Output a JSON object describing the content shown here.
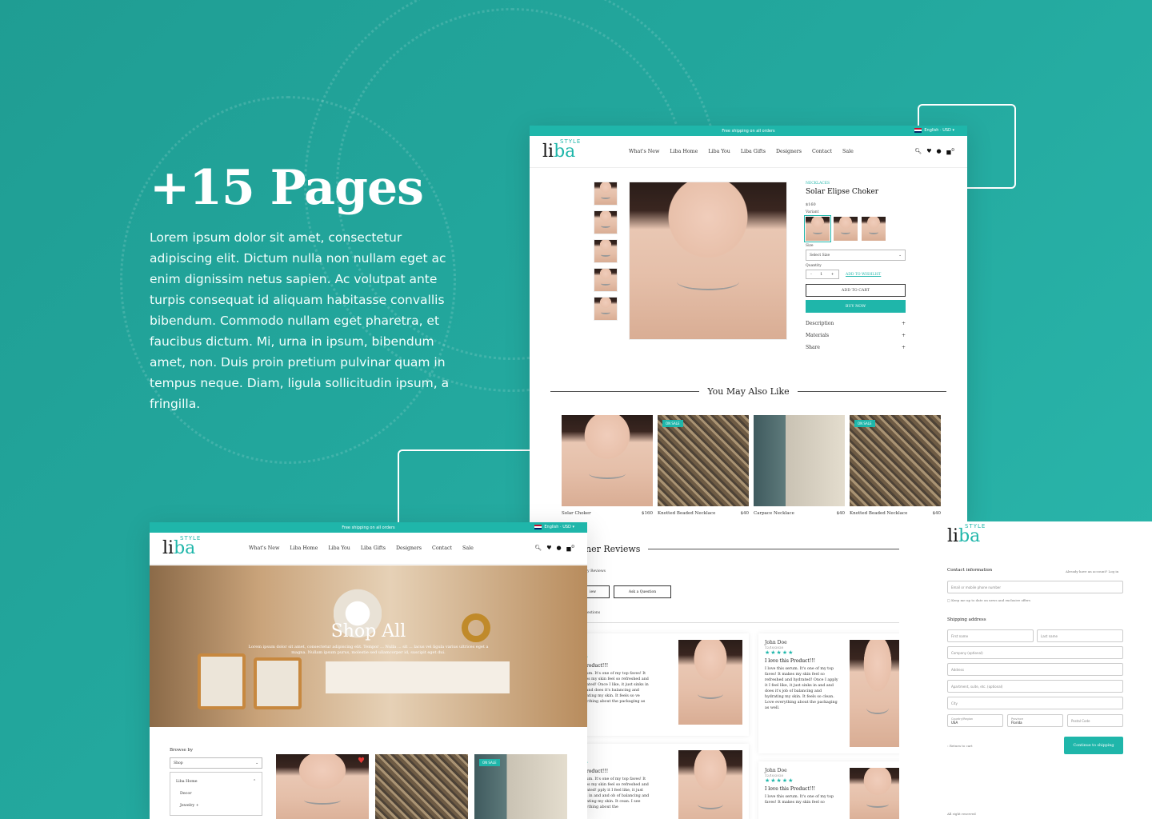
{
  "hero": {
    "title": "+15 Pages",
    "text": "Lorem ipsum dolor sit amet, consectetur adipiscing elit. Dictum nulla non nullam eget ac enim dignissim netus sapien. Ac volutpat ante turpis consequat id aliquam habitasse convallis bibendum. Commodo nullam eget pharetra, et faucibus dictum. Mi, urna in ipsum, bibendum amet, non. Duis proin pretium pulvinar quam in tempus neque. Diam, ligula sollicitudin ipsum, a fringilla."
  },
  "site": {
    "promo": "Free shipping on all orders",
    "lang": "English · USD ▾",
    "logo_main": "li",
    "logo_accent": "ba",
    "logo_sup": "STYLE",
    "nav": [
      "What's New",
      "Liba Home",
      "Liba You",
      "Liba Gifts",
      "Designers",
      "Contact",
      "Sale"
    ],
    "icons": [
      "search-icon",
      "heart-icon",
      "user-icon",
      "bag-icon"
    ],
    "cart_count": "0"
  },
  "product": {
    "category": "NECKLACES",
    "name": "Solar Elipse Choker",
    "price": "$160",
    "variant_label": "Variant",
    "size_label": "Size",
    "size_placeholder": "Select Size",
    "quantity_label": "Quantity",
    "quantity": "1",
    "wishlist": "ADD TO WISHLIST",
    "add_to_cart": "ADD TO CART",
    "buy_now": "BUY NOW",
    "accordion": [
      "Description",
      "Materials",
      "Share"
    ],
    "section_title": "You May Also Like",
    "recommend": [
      {
        "name": "Solar Choker",
        "price": "$160",
        "sale": ""
      },
      {
        "name": "Knotted Beaded Necklace",
        "price": "$40",
        "sale": "ON SALE"
      },
      {
        "name": "Carpace Necklace",
        "price": "$40",
        "sale": ""
      },
      {
        "name": "Knotted Beaded Necklace",
        "price": "$40",
        "sale": "ON SALE"
      }
    ]
  },
  "reviews": {
    "title_visible": "ner Reviews",
    "subtitle": "ry Reviews",
    "write_btn": "iew",
    "ask_btn": "Ask a Question",
    "tab": "estions",
    "cards": [
      {
        "name": "",
        "date": "",
        "stars": "★★",
        "title": "is Product!!!",
        "body": "l serum. It's one of my top faves! It makes my skin feel so refreshed and hydrated! Once I like, it just sinks in and and does it's balancing and hydrating my skin. It feels so ve everything about the packaging as well."
      },
      {
        "name": "John Doe",
        "date": "12/10/2020",
        "stars": "★★★★★",
        "title": "I love this Product!!!",
        "body": "I love this serum. It's one of my top faves! It makes my skin feel so refreshed and hydrated! Once I apply it I feel like, it just sinks in and and does it's job of balancing and hydrating my skin. It feels so clean. Love everything about the packaging as well."
      },
      {
        "name": "e",
        "date": "0",
        "stars": "★★",
        "title": "is Product!!!",
        "body": "l serum. It's one of my top faves! It makes my skin feel so refreshed and hydrated! pply it I feel like, it just sinks in and and ob of balancing and hydrating my skin. It cean. I see everything about the"
      },
      {
        "name": "John Doe",
        "date": "12/10/2020",
        "stars": "★★★★★",
        "title": "I love this Product!!!",
        "body": "I love this serum. It's one of my top faves! It makes my skin feel so"
      }
    ]
  },
  "shop": {
    "hero_title": "Shop All",
    "hero_text": "Lorem ipsum dolor sit amet, consectetur adipiscing elit. Tempor ... Nulla ... sit ... lacus vel ligula varius ultrices eget a magna. Nullam ipsum purus, molestie sed ullamcorper id, suscipit eget dui.",
    "browse_label": "Browse by",
    "browse_select": "Shop",
    "browse_items": [
      "Liba Home",
      "Decor",
      "Jewelry +"
    ],
    "sale_badge": "ON SALE"
  },
  "checkout": {
    "contact_label": "Contact information",
    "have_account": "Already have an account? Log in",
    "email_placeholder": "Email or mobile phone number",
    "newsletter": "Keep me up to date on news and exclusive offers",
    "shipping_label": "Shipping address",
    "first_name": "First name",
    "last_name": "Last name",
    "company": "Company (optional)",
    "address": "Address",
    "apartment": "Apartment, suite, etc. (optional)",
    "city": "City",
    "country_label": "Country/Region",
    "country": "USA",
    "province_label": "Province",
    "province": "Florida",
    "postal": "Postal Code",
    "return": "‹ Return to cart",
    "continue": "Continue to shipping",
    "rights": "All right reserved"
  }
}
